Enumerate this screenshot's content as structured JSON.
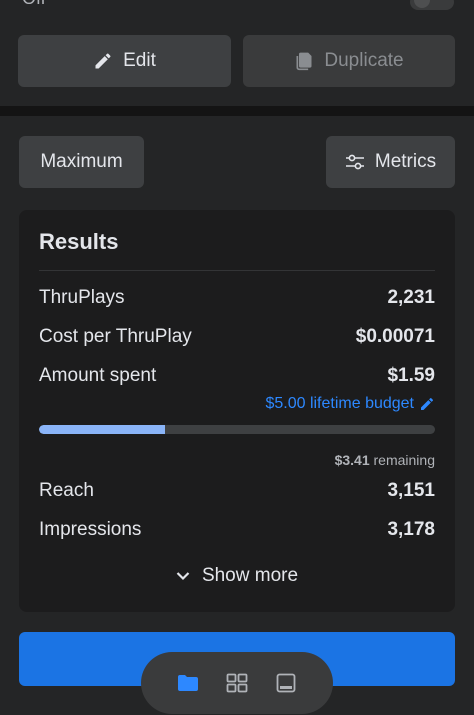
{
  "top": {
    "toggle_label": "Off",
    "edit_label": "Edit",
    "duplicate_label": "Duplicate"
  },
  "controls": {
    "maximum_label": "Maximum",
    "metrics_label": "Metrics"
  },
  "results": {
    "title": "Results",
    "rows": [
      {
        "label": "ThruPlays",
        "value": "2,231"
      },
      {
        "label": "Cost per ThruPlay",
        "value": "$0.00071"
      },
      {
        "label": "Amount spent",
        "value": "$1.59"
      }
    ],
    "budget_link": "$5.00 lifetime budget",
    "spent_fraction": 0.318,
    "remaining_amount": "$3.41",
    "remaining_word": "remaining",
    "extra_rows": [
      {
        "label": "Reach",
        "value": "3,151"
      },
      {
        "label": "Impressions",
        "value": "3,178"
      }
    ],
    "show_more_label": "Show more"
  },
  "dock": {
    "items": [
      {
        "icon": "folder-icon",
        "active": true
      },
      {
        "icon": "grid-icon",
        "active": false
      },
      {
        "icon": "tablet-icon",
        "active": false
      }
    ]
  },
  "colors": {
    "accent": "#1b74e4",
    "link": "#2d88ff",
    "progress": "#8ab4f8"
  }
}
